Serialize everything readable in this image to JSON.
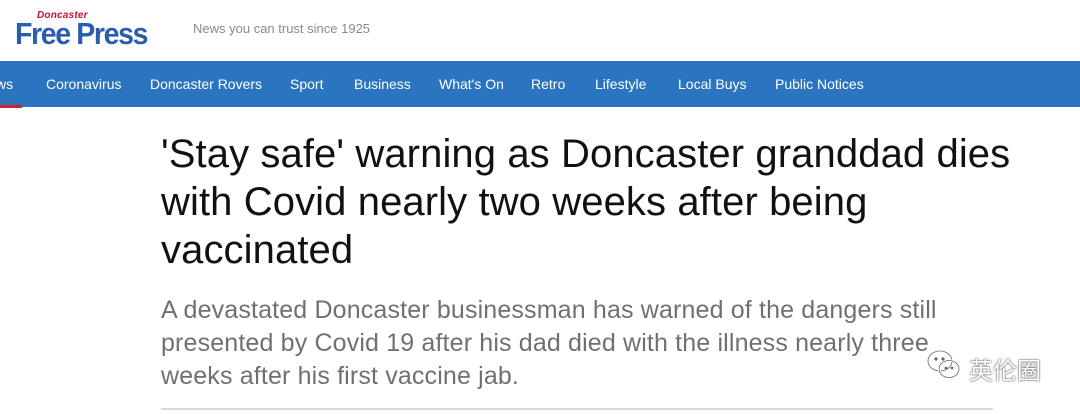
{
  "header": {
    "logo_top": "Doncaster",
    "logo_main": "Free Press",
    "tagline": "News you can trust since 1925"
  },
  "nav": {
    "items": [
      {
        "label": "ws"
      },
      {
        "label": "Coronavirus"
      },
      {
        "label": "Doncaster Rovers"
      },
      {
        "label": "Sport"
      },
      {
        "label": "Business"
      },
      {
        "label": "What's On"
      },
      {
        "label": "Retro"
      },
      {
        "label": "Lifestyle"
      },
      {
        "label": "Local Buys"
      },
      {
        "label": "Public Notices"
      }
    ],
    "active_color": "#d0202e",
    "bar_color": "#2a74c0"
  },
  "article": {
    "headline": "'Stay safe' warning as Doncaster granddad dies with Covid nearly two weeks after being vaccinated",
    "subheadline": "A devastated Doncaster businessman has warned of the dangers still presented by Covid 19 after his dad died with the illness nearly three weeks after his first vaccine jab."
  },
  "watermark": {
    "icon": "wechat-icon",
    "text": "英伦圈"
  }
}
